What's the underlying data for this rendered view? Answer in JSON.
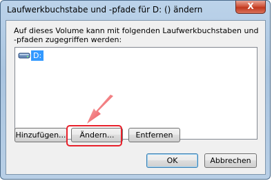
{
  "window": {
    "title": "Laufwerkbuchstabe und -pfade für D: () ändern",
    "close_label": "X"
  },
  "description": "Auf dieses Volume kann mit folgenden Laufwerkbuchstaben und -pfaden zugegriffen werden:",
  "list": {
    "items": [
      {
        "label": "D:",
        "icon": "drive-icon",
        "selected": true
      }
    ]
  },
  "buttons": {
    "add": "Hinzufügen...",
    "change": "Ändern...",
    "remove": "Entfernen",
    "ok": "OK",
    "cancel": "Abbrechen"
  },
  "annotation": {
    "arrow_color": "#e8202a",
    "highlight_color": "#e8202a"
  }
}
